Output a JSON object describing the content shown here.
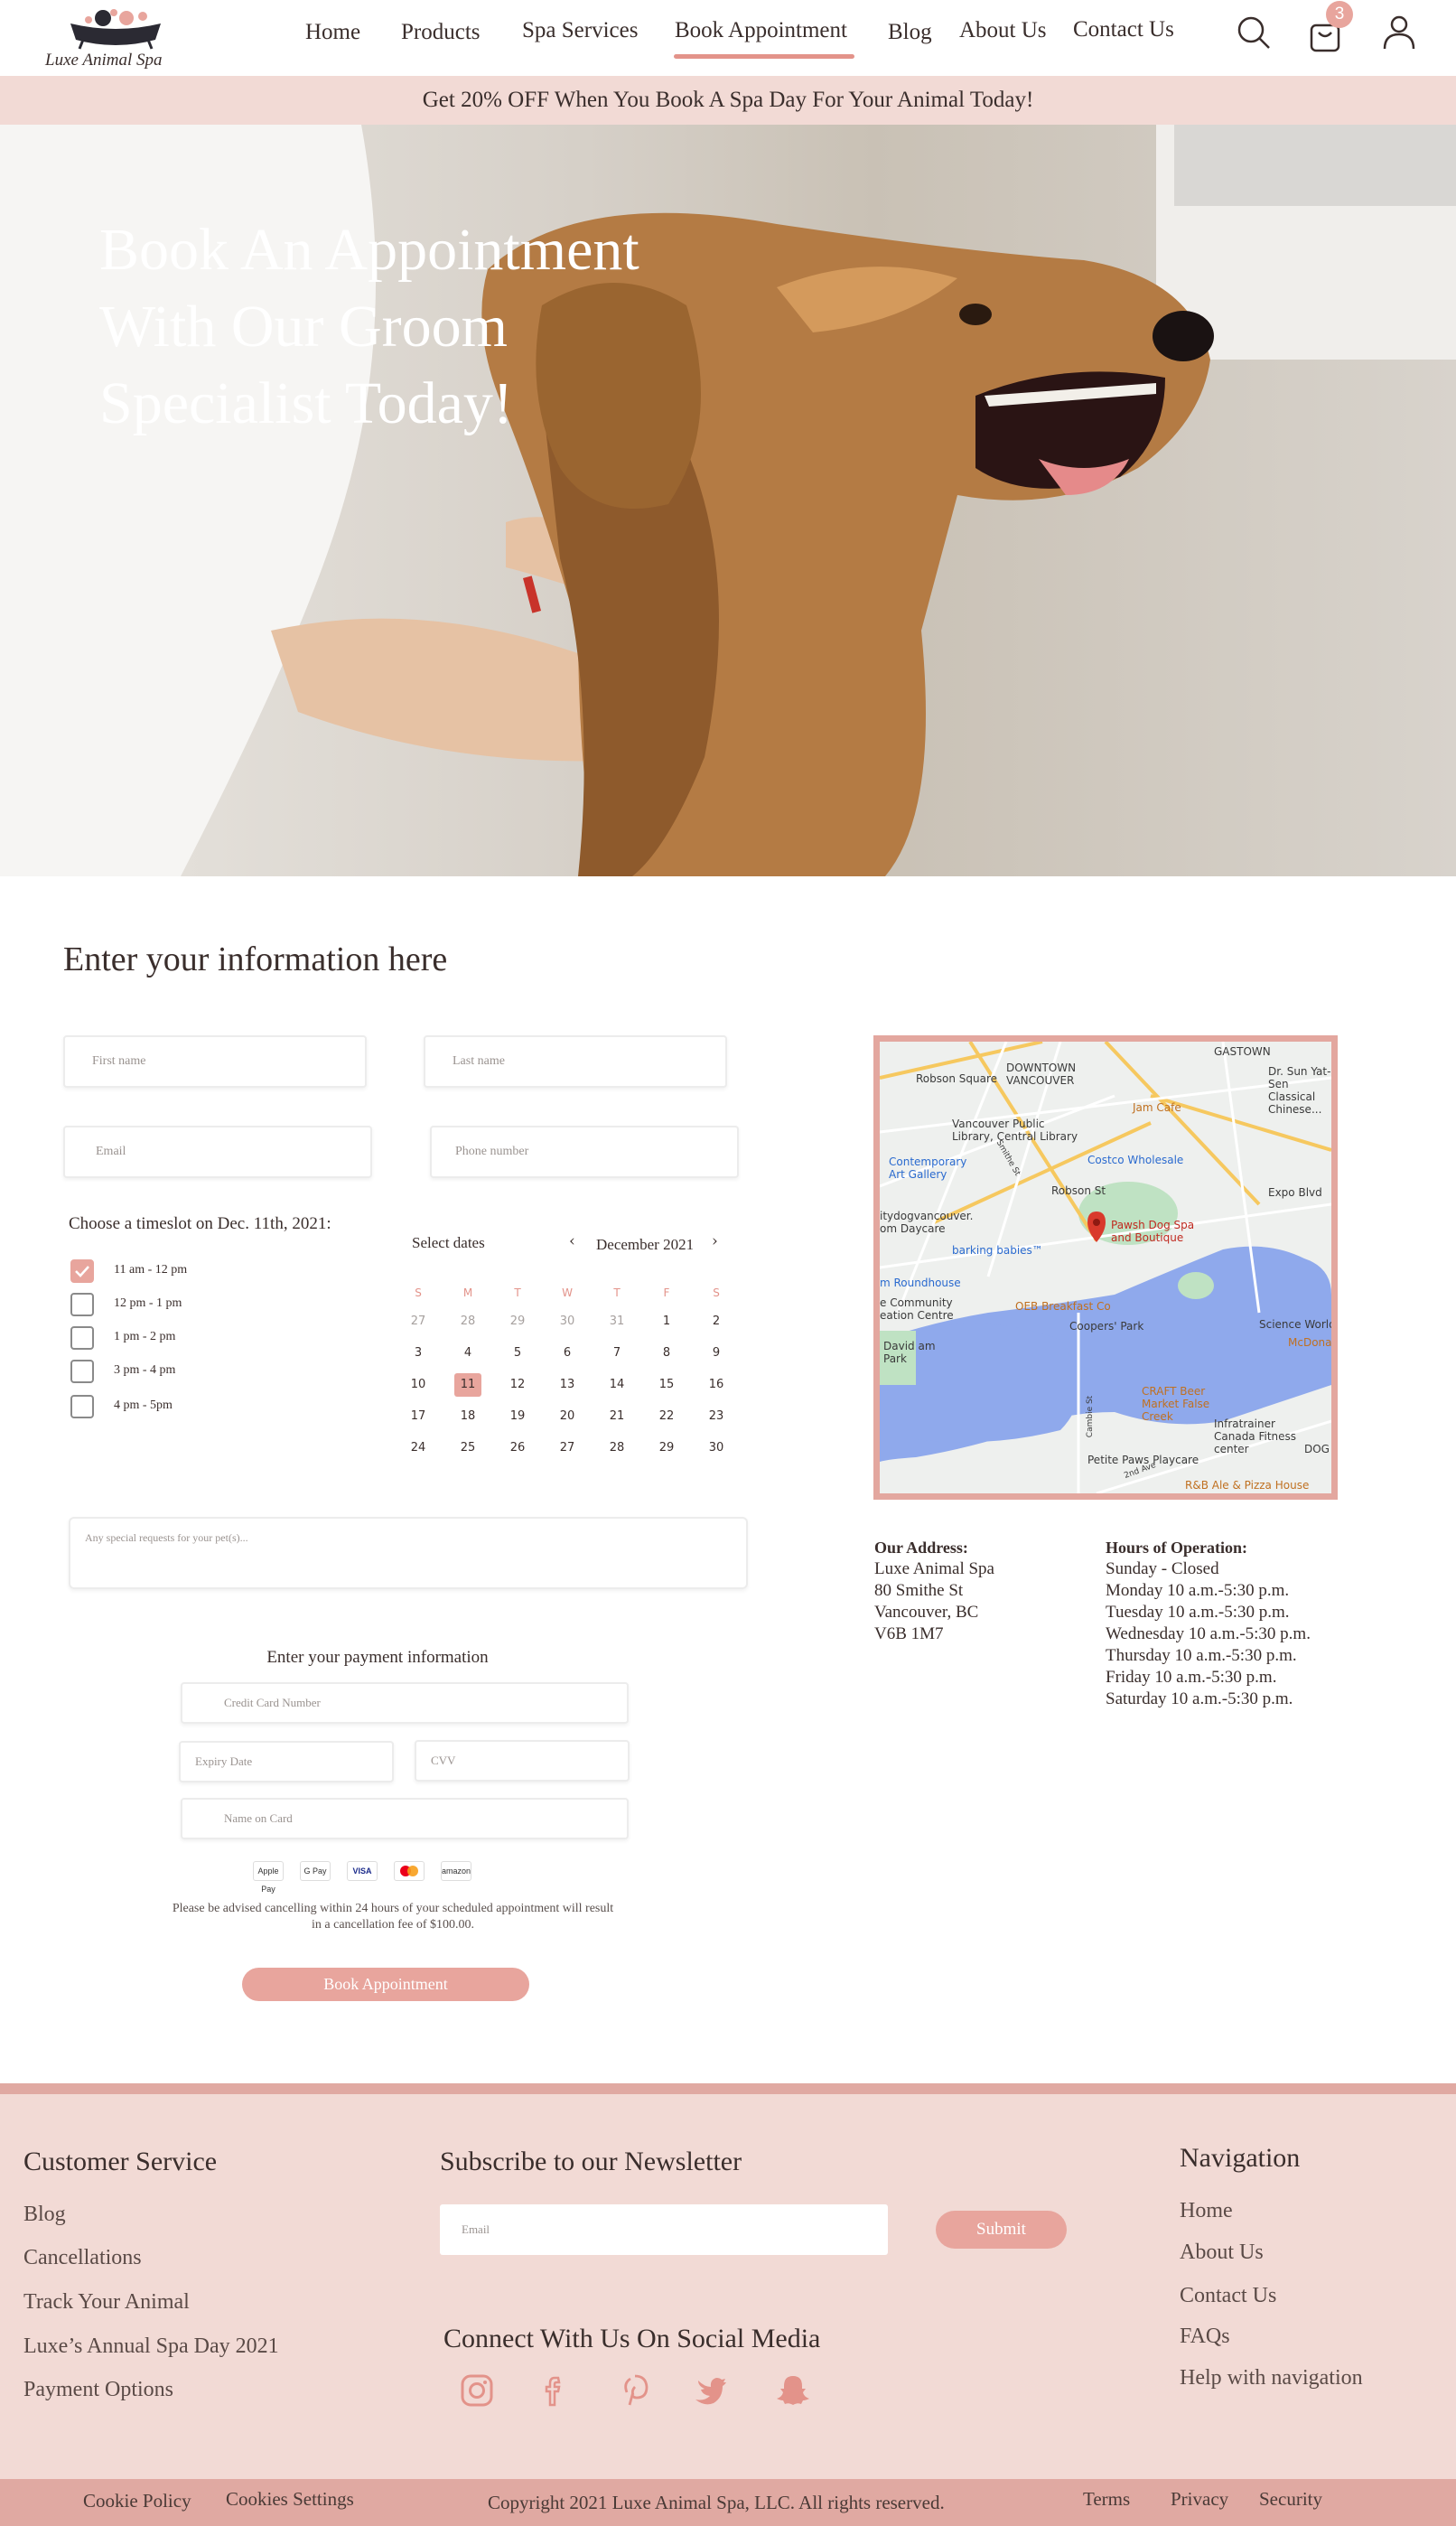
{
  "brand": {
    "name": "Luxe Animal Spa",
    "accent": "#e8a59d",
    "promo_bg": "#f2dad5"
  },
  "header": {
    "nav": [
      "Home",
      "Products",
      "Spa Services",
      "Book Appointment",
      "Blog",
      "About Us",
      "Contact Us"
    ],
    "active": "Book Appointment",
    "cart_count": "3",
    "icons": [
      "search-icon",
      "cart-icon",
      "user-icon"
    ]
  },
  "promo": {
    "text": "Get 20% OFF When You Book A Spa Day For Your Animal Today!"
  },
  "hero": {
    "title": "Book An Appointment With Our Groom Specialist Today!"
  },
  "form": {
    "title": "Enter your information here",
    "first_name": "First name",
    "last_name": "Last name",
    "email": "Email",
    "phone": "Phone number",
    "timeslot_label": "Choose a timeslot on Dec. 11th, 2021:",
    "slots": [
      "11 am - 12 pm",
      "12 pm - 1 pm",
      "1 pm - 2 pm",
      "3 pm - 4 pm",
      "4 pm - 5pm"
    ],
    "checked_slot": "11 am - 12 pm",
    "requests": "Any special requests for your pet(s)..."
  },
  "calendar": {
    "title": "Select dates",
    "month": "December 2021",
    "weekdays": [
      "S",
      "M",
      "T",
      "W",
      "T",
      "F",
      "S"
    ],
    "rows": [
      [
        "27",
        "28",
        "29",
        "30",
        "31",
        "1",
        "2"
      ],
      [
        "3",
        "4",
        "5",
        "6",
        "7",
        "8",
        "9"
      ],
      [
        "10",
        "11",
        "12",
        "13",
        "14",
        "15",
        "16"
      ],
      [
        "17",
        "18",
        "19",
        "20",
        "21",
        "22",
        "23"
      ],
      [
        "24",
        "25",
        "26",
        "27",
        "28",
        "29",
        "30"
      ]
    ],
    "selected": "11"
  },
  "payment": {
    "title": "Enter your payment information",
    "card_number": "Credit Card Number",
    "expiry": "Expiry Date",
    "cvv": "CVV",
    "name_on_card": "Name on Card",
    "methods": [
      "Apple Pay",
      "G Pay",
      "VISA",
      "Mastercard",
      "amazon"
    ],
    "note": "Please be advised cancelling within 24 hours of your scheduled appointment will result in a cancellation fee of $100.00.",
    "button": "Book Appointment"
  },
  "map": {
    "labels": [
      "GASTOWN",
      "Robson Square",
      "DOWNTOWN VANCOUVER",
      "Dr. Sun Yat-Sen Classical Chinese...",
      "Jam Cafe",
      "Vancouver Public Library, Central Library",
      "Contemporary Art Gallery",
      "Costco Wholesale",
      "Robson St",
      "Expo Blvd",
      "itydogvancouver. om Daycare",
      "Pawsh Dog Spa and Boutique",
      "barking babies™",
      "m Roundhouse",
      "OEB Breakfast Co",
      "e Community eation Centre",
      "Coopers' Park",
      "Science World",
      "McDona",
      "David am Park",
      "CRAFT Beer Market False Creek",
      "Infratrainer Canada Fitness center",
      "Petite Paws Playcare",
      "DOG Proc",
      "R&B Ale & Pizza House",
      "Smithe St",
      "Cambie St",
      "2nd Ave"
    ]
  },
  "address": {
    "title": "Our Address:",
    "lines": [
      "Luxe Animal Spa",
      "80 Smithe St",
      "Vancouver, BC",
      "V6B 1M7"
    ]
  },
  "hours": {
    "title": "Hours of Operation:",
    "lines": [
      "Sunday - Closed",
      "Monday 10 a.m.-5:30 p.m.",
      "Tuesday 10 a.m.-5:30 p.m.",
      "Wednesday 10 a.m.-5:30 p.m.",
      "Thursday 10 a.m.-5:30 p.m.",
      "Friday 10 a.m.-5:30 p.m.",
      "Saturday 10 a.m.-5:30 p.m."
    ]
  },
  "footer": {
    "customer_service": {
      "title": "Customer Service",
      "links": [
        "Blog",
        "Cancellations",
        "Track Your Animal",
        "Luxe’s Annual Spa Day 2021",
        "Payment Options"
      ]
    },
    "newsletter": {
      "title": "Subscribe to our Newsletter",
      "placeholder": "Email",
      "button": "Submit"
    },
    "social": {
      "title": "Connect With Us On Social Media",
      "icons": [
        "instagram-icon",
        "facebook-icon",
        "pinterest-icon",
        "twitter-icon",
        "snapchat-icon"
      ]
    },
    "navigation": {
      "title": "Navigation",
      "links": [
        "Home",
        "About Us",
        "Contact Us",
        "FAQs",
        "Help with navigation"
      ]
    }
  },
  "bottom_bar": {
    "left": [
      "Cookie Policy",
      "Cookies Settings"
    ],
    "copyright": "Copyright 2021 Luxe Animal Spa, LLC. All rights reserved.",
    "right": [
      "Terms",
      "Privacy",
      "Security"
    ]
  }
}
